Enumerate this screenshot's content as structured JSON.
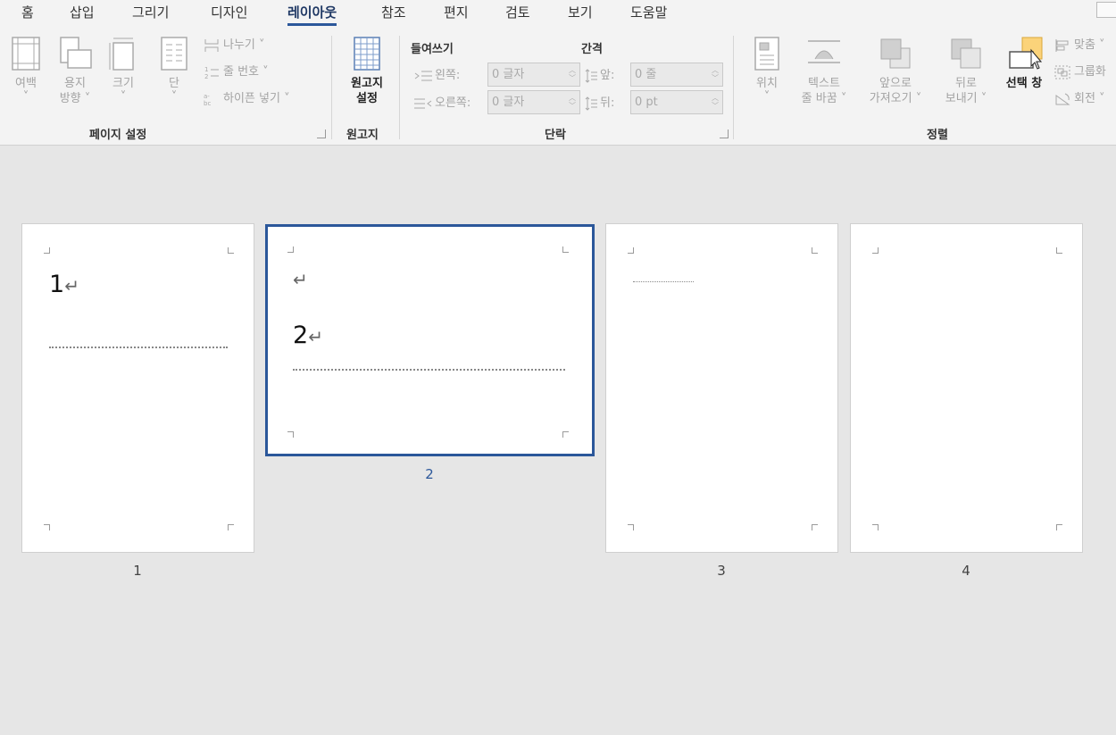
{
  "tabs": [
    "홈",
    "삽입",
    "그리기",
    "디자인",
    "레이아웃",
    "참조",
    "편지",
    "검토",
    "보기",
    "도움말"
  ],
  "active_tab": "레이아웃",
  "ribbon": {
    "page_setup": {
      "margins": "여백",
      "orientation_1": "용지",
      "orientation_2": "방향 ˅",
      "size": "크기",
      "columns": "단",
      "breaks": "나누기 ˅",
      "line_numbers": "줄 번호 ˅",
      "hyphenation": "하이픈 넣기 ˅",
      "label": "페이지 설정"
    },
    "manuscript": {
      "setup_1": "원고지",
      "setup_2": "설정",
      "label": "원고지"
    },
    "paragraph": {
      "indent_head": "들여쓰기",
      "spacing_head": "간격",
      "left_label": "왼쪽:",
      "left_value": "0 글자",
      "right_label": "오른쪽:",
      "right_value": "0 글자",
      "before_label": "앞:",
      "before_value": "0 줄",
      "after_label": "뒤:",
      "after_value": "0 pt",
      "label": "단락"
    },
    "arrange": {
      "position": "위치",
      "wrap_1": "텍스트",
      "wrap_2": "줄 바꿈 ˅",
      "forward_1": "앞으로",
      "forward_2": "가져오기 ˅",
      "backward_1": "뒤로",
      "backward_2": "보내기 ˅",
      "selection_pane": "선택 창",
      "align": "맞춤 ˅",
      "group": "그룹화",
      "rotate": "회전 ˅",
      "label": "정렬"
    }
  },
  "pages": [
    {
      "number": "1",
      "heading": "1",
      "selected": false
    },
    {
      "number": "2",
      "heading": "2",
      "selected": true
    },
    {
      "number": "3",
      "heading": "",
      "selected": false
    },
    {
      "number": "4",
      "heading": "",
      "selected": false
    }
  ],
  "colors": {
    "accent": "#2b579a",
    "ribbon_bg": "#f3f3f3",
    "canvas_bg": "#e6e6e6"
  },
  "icons": [
    "margins-icon",
    "orientation-icon",
    "size-icon",
    "columns-icon",
    "breaks-icon",
    "line-numbers-icon",
    "hyphenation-icon",
    "manuscript-icon",
    "indent-left-icon",
    "indent-right-icon",
    "spacing-before-icon",
    "spacing-after-icon",
    "position-icon",
    "wrap-text-icon",
    "bring-forward-icon",
    "send-backward-icon",
    "selection-pane-icon",
    "align-icon",
    "group-icon",
    "rotate-icon",
    "return-arrow-icon"
  ]
}
